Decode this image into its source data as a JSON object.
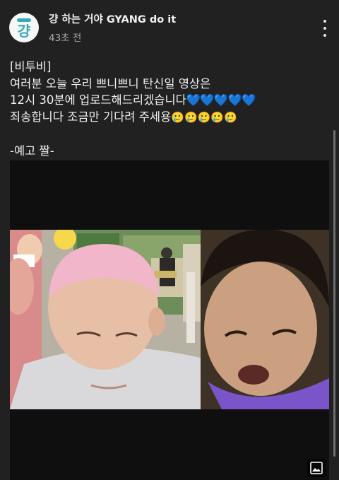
{
  "post": {
    "channel_name": "걍 하는 거야 GYANG do it",
    "avatar_text": "걍",
    "time_ago": "43초 전",
    "lines": [
      "[비투비]",
      "여러분 오늘 우리 쁘니쁘니 탄신일 영상은",
      "12시 30분에 업로드해드리겠습니다",
      "죄송합니다 조금만 기다려 주세용",
      "",
      "-예고 짤-"
    ],
    "line3_hearts": "💙💙💙💙💙",
    "line4_emojis": "🥲🥲🥲🥲🥲"
  },
  "icons": {
    "menu": "more-vertical-icon",
    "image": "image-icon",
    "avatar": "channel-avatar"
  },
  "colors": {
    "background": "#212121",
    "text": "#f1f1f1",
    "secondary_text": "#aaaaaa",
    "heart": "#1e88e5",
    "avatar_accent": "#37a9b8"
  }
}
